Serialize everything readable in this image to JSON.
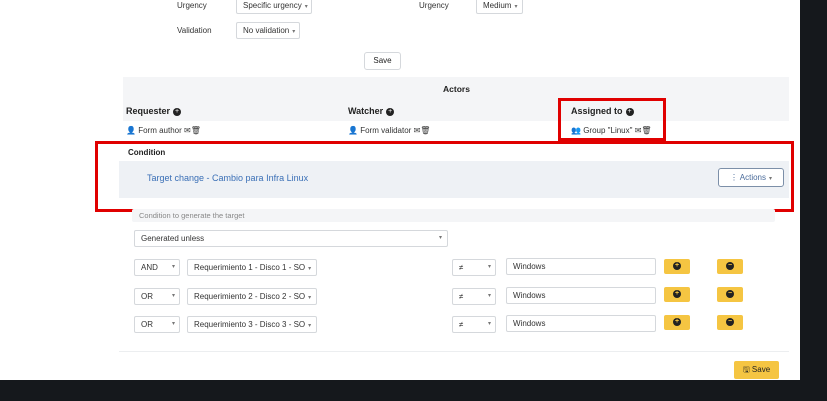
{
  "top_form": {
    "urgency_label_left": "Urgency",
    "urgency_value_left": "Specific urgency",
    "urgency_label_right": "Urgency",
    "urgency_value_right": "Medium",
    "validation_label": "Validation",
    "validation_value": "No validation",
    "save_label": "Save"
  },
  "actors": {
    "title": "Actors",
    "requester": {
      "label": "Requester",
      "item": "Form author"
    },
    "watcher": {
      "label": "Watcher",
      "item": "Form validator"
    },
    "assigned": {
      "label": "Assigned to",
      "item": "Group \"Linux\""
    }
  },
  "condition": {
    "heading": "Condition",
    "target_link": "Target change - Cambio para Infra Linux",
    "actions_label": "Actions",
    "placeholder": "Condition to generate the target",
    "mode_value": "Generated unless",
    "rows": [
      {
        "logic": "AND",
        "field": "Requerimiento 1 - Disco 1 - SO",
        "operator": "≠",
        "value": "Windows"
      },
      {
        "logic": "OR",
        "field": "Requerimiento 2 - Disco 2 - SO",
        "operator": "≠",
        "value": "Windows"
      },
      {
        "logic": "OR",
        "field": "Requerimiento 3 - Disco 3 - SO",
        "operator": "≠",
        "value": "Windows"
      }
    ]
  },
  "footer": {
    "save_label": "Save"
  },
  "colors": {
    "accent_yellow": "#f5c542",
    "highlight_red": "#e00000",
    "link_blue": "#3a6fb6"
  },
  "icons": [
    "plus-circle-icon",
    "user-icon",
    "envelope-icon",
    "trash-icon",
    "users-icon",
    "ellipsis-vertical-icon",
    "chevron-down-icon",
    "save-icon"
  ]
}
